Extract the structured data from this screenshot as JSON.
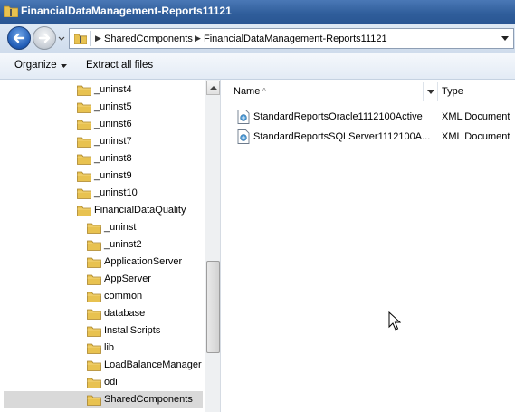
{
  "window": {
    "title": "FinancialDataManagement-Reports11121"
  },
  "address": {
    "crumbs": [
      "SharedComponents",
      "FinancialDataManagement-Reports11121"
    ]
  },
  "toolbar": {
    "organize_label": "Organize",
    "extract_label": "Extract all files"
  },
  "tree": {
    "items": [
      {
        "label": "_uninst4",
        "level": 1
      },
      {
        "label": "_uninst5",
        "level": 1
      },
      {
        "label": "_uninst6",
        "level": 1
      },
      {
        "label": "_uninst7",
        "level": 1
      },
      {
        "label": "_uninst8",
        "level": 1
      },
      {
        "label": "_uninst9",
        "level": 1
      },
      {
        "label": "_uninst10",
        "level": 1
      },
      {
        "label": "FinancialDataQuality",
        "level": 1
      },
      {
        "label": "_uninst",
        "level": 2
      },
      {
        "label": "_uninst2",
        "level": 2
      },
      {
        "label": "ApplicationServer",
        "level": 2
      },
      {
        "label": "AppServer",
        "level": 2
      },
      {
        "label": "common",
        "level": 2
      },
      {
        "label": "database",
        "level": 2
      },
      {
        "label": "InstallScripts",
        "level": 2
      },
      {
        "label": "lib",
        "level": 2
      },
      {
        "label": "LoadBalanceManager",
        "level": 2
      },
      {
        "label": "odi",
        "level": 2
      },
      {
        "label": "SharedComponents",
        "level": 2,
        "selected": true
      }
    ]
  },
  "columns": {
    "name": "Name",
    "type": "Type"
  },
  "files": [
    {
      "name": "StandardReportsOracle1112100Active",
      "type": "XML Document"
    },
    {
      "name": "StandardReportsSQLServer1112100A...",
      "type": "XML Document"
    }
  ],
  "icons": {
    "folder": "folder-icon",
    "xml": "xml-document-icon",
    "back": "back-arrow-icon",
    "forward": "forward-arrow-icon"
  },
  "colors": {
    "titlebar": "#2f5d9a",
    "selection": "#d9d9d9",
    "folder": "#e8c250"
  }
}
